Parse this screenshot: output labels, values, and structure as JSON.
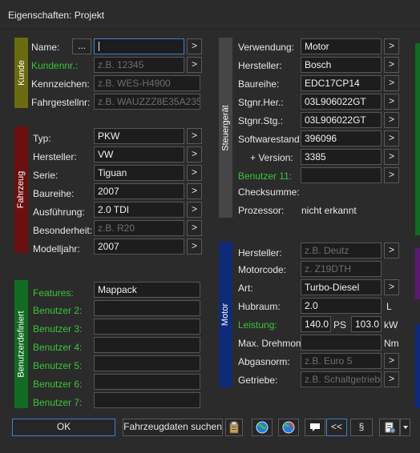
{
  "window": {
    "title": "Eigenschaften: Projekt"
  },
  "colors": {
    "kunde": "#6b6b12",
    "fahrzeug": "#6b1010",
    "benutzer": "#126b22",
    "steuergeraet": "#464646",
    "motor": "#0f2a78",
    "accent": "#3b7fd0",
    "green_label": "#39c539"
  },
  "kunde": {
    "section_label": "Kunde",
    "name_label": "Name:",
    "name_value": "",
    "name_dots": "...",
    "kundennr_label": "Kundennr.:",
    "kundennr_placeholder": "z.B. 12345",
    "kennzeichen_label": "Kennzeichen:",
    "kennzeichen_placeholder": "z.B. WES-H4900",
    "fahrgestellnr_label": "Fahrgestellnr:",
    "fahrgestellnr_placeholder": "z.B. WAUZZZ8E35A235"
  },
  "fahrzeug": {
    "section_label": "Fahrzeug",
    "typ_label": "Typ:",
    "typ_value": "PKW",
    "hersteller_label": "Hersteller:",
    "hersteller_value": "VW",
    "serie_label": "Serie:",
    "serie_value": "Tiguan",
    "baureihe_label": "Baureihe:",
    "baureihe_value": "2007",
    "ausfuehrung_label": "Ausführung:",
    "ausfuehrung_value": "2.0 TDI",
    "besonderheit_label": "Besonderheit:",
    "besonderheit_placeholder": "z.B. R20",
    "modelljahr_label": "Modelljahr:",
    "modelljahr_value": "2007"
  },
  "benutzerdefiniert": {
    "section_label": "Benutzerdefiniert",
    "features_label": "Features:",
    "features_value": "Mappack",
    "fields": [
      {
        "label": "Benutzer 2:",
        "value": ""
      },
      {
        "label": "Benutzer 3:",
        "value": ""
      },
      {
        "label": "Benutzer 4:",
        "value": ""
      },
      {
        "label": "Benutzer 5:",
        "value": ""
      },
      {
        "label": "Benutzer 6:",
        "value": ""
      },
      {
        "label": "Benutzer 7:",
        "value": ""
      }
    ]
  },
  "steuergeraet": {
    "section_label": "Steuergerät",
    "verwendung_label": "Verwendung:",
    "verwendung_value": "Motor",
    "hersteller_label": "Hersteller:",
    "hersteller_value": "Bosch",
    "baureihe_label": "Baureihe:",
    "baureihe_value": "EDC17CP14",
    "stgnr_her_label": "Stgnr.Her.:",
    "stgnr_her_value": "03L906022GT",
    "stgnr_stg_label": "Stgnr.Stg.:",
    "stgnr_stg_value": "03L906022GT",
    "softwarestand_label": "Softwarestand:",
    "softwarestand_value": "396096",
    "version_label": "+ Version:",
    "version_value": "3385",
    "benutzer11_label": "Benutzer 11:",
    "benutzer11_value": "",
    "checksumme_label": "Checksumme:",
    "prozessor_label": "Prozessor:",
    "prozessor_value": "nicht erkannt"
  },
  "motor": {
    "section_label": "Motor",
    "hersteller_label": "Hersteller:",
    "hersteller_placeholder": "z.B. Deutz",
    "motorcode_label": "Motorcode:",
    "motorcode_placeholder": "z. Z19DTH",
    "art_label": "Art:",
    "art_value": "Turbo-Diesel",
    "hubraum_label": "Hubraum:",
    "hubraum_value": "2.0",
    "hubraum_unit": "L",
    "leistung_label": "Leistung:",
    "leistung_ps_value": "140.0",
    "leistung_ps_unit": "PS",
    "leistung_kw_value": "103.0",
    "leistung_kw_unit": "kW",
    "drehmoment_label": "Max. Drehmom.",
    "drehmoment_value": "",
    "drehmoment_unit": "Nm",
    "abgasnorm_label": "Abgasnorm:",
    "abgasnorm_placeholder": "z.B. Euro 5",
    "getriebe_label": "Getriebe:",
    "getriebe_placeholder": "z.B. Schaltgetriebe"
  },
  "footer": {
    "ok_label": "OK",
    "suchen_label": "Fahrzeugdaten suchen",
    "back_label": "<<",
    "paragraph_label": "§"
  },
  "common": {
    "arrow": ">"
  }
}
